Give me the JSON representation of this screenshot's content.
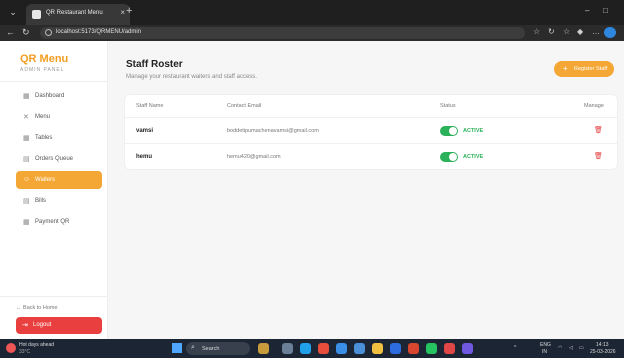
{
  "browser": {
    "tab_title": "QR Restaurant Menu",
    "tab_close": "×",
    "new_tab": "+",
    "url": "localhost:5173/QRMENU/admin",
    "minimize": "–",
    "maximize": "□"
  },
  "sidebar": {
    "brand": "QR Menu",
    "subtitle": "ADMIN PANEL",
    "items": [
      {
        "label": "Dashboard",
        "icon": "grid-icon",
        "glyph": "▦",
        "active": false
      },
      {
        "label": "Menu",
        "icon": "menu-icon",
        "glyph": "✕",
        "active": false
      },
      {
        "label": "Tables",
        "icon": "table-icon",
        "glyph": "▦",
        "active": false
      },
      {
        "label": "Orders Queue",
        "icon": "orders-icon",
        "glyph": "▤",
        "active": false
      },
      {
        "label": "Waiters",
        "icon": "people-icon",
        "glyph": "☺",
        "active": true
      },
      {
        "label": "Bills",
        "icon": "bill-icon",
        "glyph": "▤",
        "active": false
      },
      {
        "label": "Payment QR",
        "icon": "qr-icon",
        "glyph": "▦",
        "active": false
      }
    ],
    "back_link": "← Back to Home",
    "logout": "Logout"
  },
  "main": {
    "title": "Staff Roster",
    "subtitle": "Manage your restaurant waiters and staff access.",
    "register_button": "Register Staff",
    "table": {
      "headers": [
        "Staff Name",
        "Contact Email",
        "Status",
        "Manage"
      ],
      "rows": [
        {
          "name": "vamsi",
          "email": "boddetipumachenavamsi@gmail.com",
          "status": "ACTIVE"
        },
        {
          "name": "hemu",
          "email": "hemu420@gmail.com",
          "status": "ACTIVE"
        }
      ]
    }
  },
  "taskbar": {
    "weather_title": "Hot days ahead",
    "weather_temp": "33°C",
    "search": "Search",
    "lang": "ENG",
    "lang_region": "IN",
    "time": "14:13",
    "date": "25-03-2026"
  },
  "colors": {
    "accent": "#f4a734",
    "active_status": "#2bb159",
    "logout": "#ea3f3f"
  }
}
